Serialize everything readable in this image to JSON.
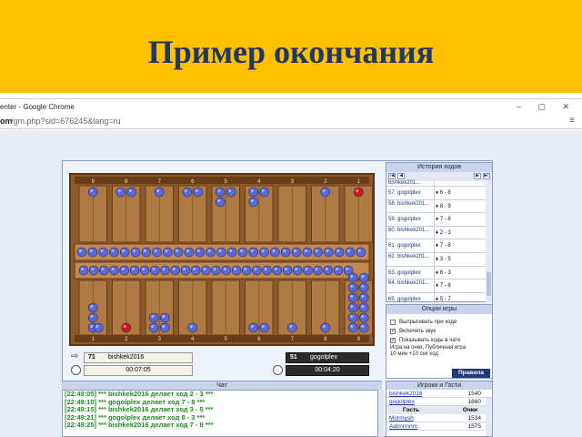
{
  "slide": {
    "title": "Пример окончания"
  },
  "browser": {
    "window_title": "enter - Google Chrome",
    "url_host": "om",
    "url_path": "/gm.php?sid=676245&lang=ru",
    "window_buttons": "– ▢ ✕",
    "menu_icon": "≡"
  },
  "board": {
    "point_numbers": [
      "9",
      "8",
      "7",
      "6",
      "5",
      "4",
      "3",
      "2",
      "1"
    ],
    "bottom_numbers": [
      "1",
      "2",
      "3",
      "4",
      "5",
      "6",
      "7",
      "8",
      "9"
    ]
  },
  "players": {
    "p1": {
      "score": "71",
      "name": "bishkek2016",
      "time": "00:07:05"
    },
    "p2": {
      "score": "51",
      "name": "gogolplex",
      "time": "00:04:20"
    }
  },
  "history": {
    "title": "История ходов",
    "rows": [
      {
        "label": "bishkek201...",
        "move": ""
      },
      {
        "label": "57. gogolplex",
        "move": "♦ 6 - 8"
      },
      {
        "label": "58. bishkek201...",
        "move": "♦ 8 - 9"
      },
      {
        "label": "59. gogolplex",
        "move": "♦ 7 - 8"
      },
      {
        "label": "60. bishkek201...",
        "move": "♦ 2 - 3"
      },
      {
        "label": "61. gogolplex",
        "move": "♦ 7 - 8"
      },
      {
        "label": "62. bishkek201...",
        "move": "♦ 3 - 5"
      },
      {
        "label": "63. gogolplex",
        "move": "♦ 8 - 3"
      },
      {
        "label": "64. bishkek201...",
        "move": "♦ 7 - 8"
      },
      {
        "label": "65. gogolplex",
        "move": "♦ 5 - 7"
      }
    ]
  },
  "options": {
    "title": "Опции игры",
    "items": [
      {
        "label": "Выпрыгивать при ходе",
        "checked": false
      },
      {
        "label": "Включить звук",
        "checked": true
      },
      {
        "label": "Показывать ходы в чате",
        "checked": true
      }
    ],
    "game_info_1": "Игра на очки, Публичная игра",
    "game_info_2": "10 мин +10 сек ход",
    "rules_button": "Правила"
  },
  "chat": {
    "title": "Чат",
    "lines": [
      "[22:49:05] *** bishkek2016 делает ход 2 - 3 ***",
      "[22:49:10] *** gogolplex делает ход 7 - 8 ***",
      "[22:49:15] *** bishkek2016 делает ход 3 - 5 ***",
      "[22:49:21] *** gogolplex делает ход 8 - 3 ***",
      "[22:49:25] *** bishkek2016 делает ход 7 - 8 ***"
    ]
  },
  "people": {
    "title": "Игроки и Гости",
    "top_rows": [
      {
        "name": "bishkek2016",
        "score": "1540"
      },
      {
        "name": "gogolplex",
        "score": "1660"
      }
    ],
    "col_guest": "Гость",
    "col_points": "Очки",
    "guests": [
      {
        "name": "Mormysh",
        "score": "1534"
      },
      {
        "name": "Aidmnnnm",
        "score": "1575"
      }
    ]
  },
  "colors": {
    "banner": "#ffc000",
    "title_text": "#1f3864",
    "checker_blue": "#5a6ad8",
    "checker_red": "#d01818",
    "chat_text": "#1f8b1f"
  }
}
